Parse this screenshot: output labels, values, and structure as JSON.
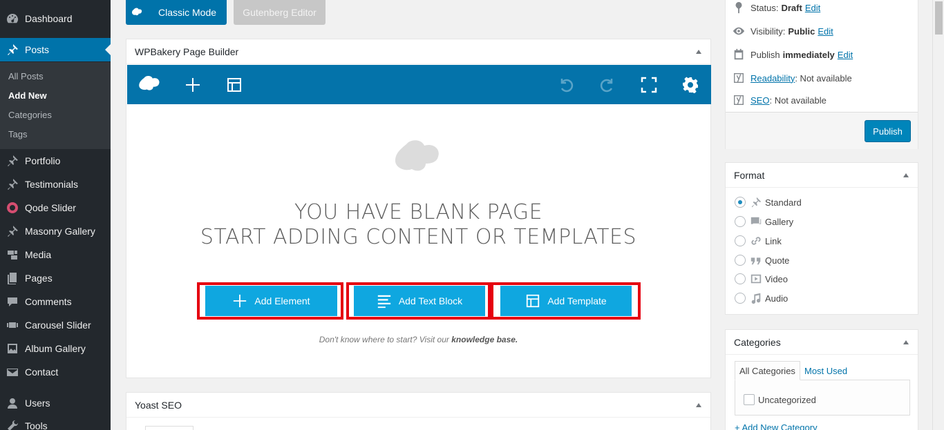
{
  "sidebar": {
    "top_items": [
      {
        "label": "Dashboard",
        "icon": "dashboard-icon"
      },
      {
        "label": "Posts",
        "icon": "pin-icon"
      }
    ],
    "submenu": [
      "All Posts",
      "Add New",
      "Categories",
      "Tags"
    ],
    "items": [
      {
        "label": "Portfolio",
        "icon": "pin-icon"
      },
      {
        "label": "Testimonials",
        "icon": "pin-icon"
      },
      {
        "label": "Qode Slider",
        "icon": "record-icon"
      },
      {
        "label": "Masonry Gallery",
        "icon": "pin-icon"
      },
      {
        "label": "Media",
        "icon": "media-icon"
      },
      {
        "label": "Pages",
        "icon": "page-icon"
      },
      {
        "label": "Comments",
        "icon": "comment-icon"
      },
      {
        "label": "Carousel Slider",
        "icon": "carousel-icon"
      },
      {
        "label": "Album Gallery",
        "icon": "album-icon"
      },
      {
        "label": "Contact",
        "icon": "mail-icon"
      },
      {
        "label": "Users",
        "icon": "user-icon"
      },
      {
        "label": "Tools",
        "icon": "wrench-icon"
      }
    ]
  },
  "mode_buttons": {
    "classic": "Classic Mode",
    "gutenberg": "Gutenberg Editor"
  },
  "wpbakery": {
    "title": "WPBakery Page Builder",
    "blank_line1": "YOU HAVE BLANK PAGE",
    "blank_line2": "START ADDING CONTENT OR TEMPLATES",
    "add_element": "Add Element",
    "add_text_block": "Add Text Block",
    "add_template": "Add Template",
    "hint_prefix": "Don't know where to start? Visit our ",
    "hint_link": "knowledge base."
  },
  "yoast": {
    "title": "Yoast SEO"
  },
  "publish": {
    "status_label": "Status:",
    "status_value": "Draft",
    "visibility_label": "Visibility:",
    "visibility_value": "Public",
    "publish_label": "Publish",
    "publish_value": "immediately",
    "edit": "Edit",
    "readability_link": "Readability",
    "readability_value": ": Not available",
    "seo_link": "SEO",
    "seo_value": ": Not available",
    "button": "Publish"
  },
  "format": {
    "title": "Format",
    "options": [
      {
        "label": "Standard",
        "checked": true,
        "icon": "pin-icon"
      },
      {
        "label": "Gallery",
        "checked": false,
        "icon": "gallery-icon"
      },
      {
        "label": "Link",
        "checked": false,
        "icon": "link-icon"
      },
      {
        "label": "Quote",
        "checked": false,
        "icon": "quote-icon"
      },
      {
        "label": "Video",
        "checked": false,
        "icon": "video-icon"
      },
      {
        "label": "Audio",
        "checked": false,
        "icon": "audio-icon"
      }
    ]
  },
  "categories": {
    "title": "Categories",
    "tab_all": "All Categories",
    "tab_used": "Most Used",
    "items": [
      "Uncategorized"
    ],
    "add_new": "+ Add New Category"
  },
  "colors": {
    "accent": "#0073aa",
    "builder_bar": "#0473aa",
    "add_button": "#0fa7e0",
    "highlight": "#e5000f"
  }
}
